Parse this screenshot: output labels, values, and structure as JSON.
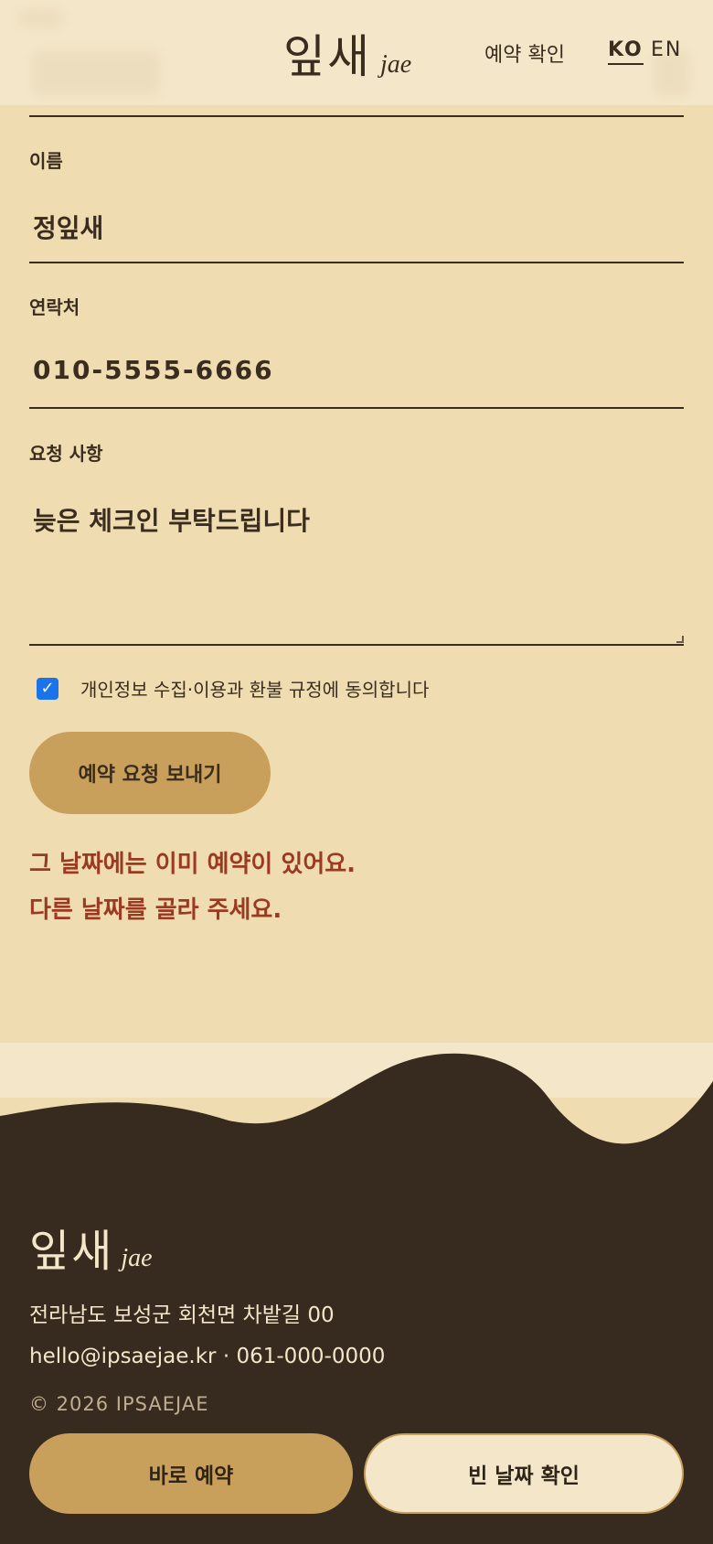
{
  "header": {
    "brand_ko": "잎새",
    "brand_jae": "jae",
    "nav_check": "예약 확인",
    "lang_ko": "KO",
    "lang_en": "EN"
  },
  "form": {
    "name_label": "이름",
    "name_value": "정잎새",
    "phone_label": "연락처",
    "phone_value": "010-5555-6666",
    "request_label": "요청 사항",
    "request_value": "늦은 체크인 부탁드립니다",
    "consent_checked": true,
    "consent_text": "개인정보 수집·이용과  환불 규정에 동의합니다",
    "submit_label": "예약 요청 보내기",
    "error_line1": "그 날짜에는 이미 예약이 있어요.",
    "error_line2": "다른 날짜를 골라 주세요."
  },
  "footer": {
    "brand_ko": "잎새",
    "brand_jae": "jae",
    "address": "전라남도 보성군 회천면 차밭길 00",
    "contact": "hello@ipsaejae.kr · 061-000-0000",
    "copyright": "© 2026 IPSAEJAE",
    "book_button": "바로 예약",
    "dates_button": "빈 날짜 확인"
  },
  "colors": {
    "page_bg": "#efdcb0",
    "header_bg": "#f4e7c9",
    "dark_brown": "#3a2c1e",
    "gold": "#c8a05c",
    "error_red": "#9b3a22",
    "checkbox_blue": "#1a73e8"
  },
  "icons": {
    "checkbox": "check-icon"
  }
}
